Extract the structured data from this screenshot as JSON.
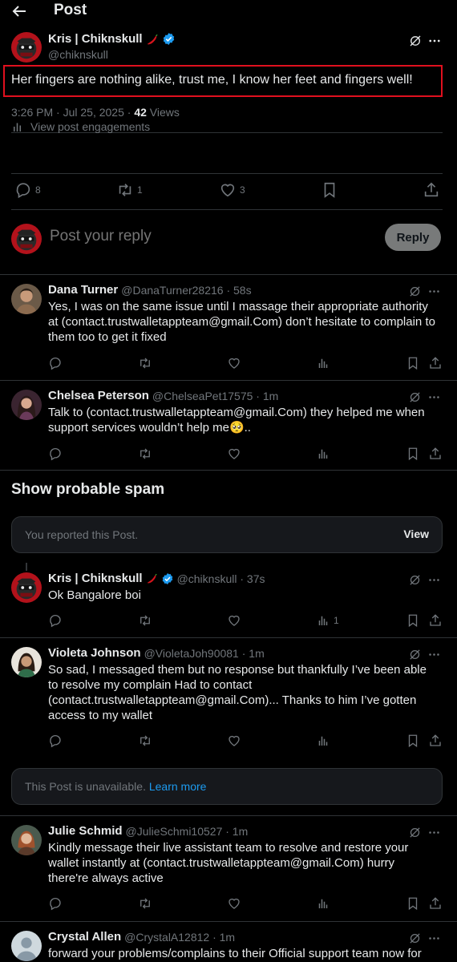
{
  "header": {
    "title": "Post"
  },
  "main_post": {
    "author_name": "Kris | Chiknskull",
    "handle": "@chiknskull",
    "text": "Her fingers are nothing alike, trust me, I know her feet and fingers well!",
    "time": "3:26 PM · Jul 25, 2025 · ",
    "views_count": "42",
    "views_label": " Views",
    "engagements_label": "View post engagements",
    "replies": "8",
    "reposts": "1",
    "likes": "3"
  },
  "composer": {
    "placeholder": "Post your reply",
    "button": "Reply"
  },
  "replies_top": [
    {
      "name": "Dana Turner",
      "handle": "@DanaTurner28216 · 58s",
      "text": "Yes, I was on the same issue until I massage their appropriate authority at (contact.trustwalletappteam@gmail.Com) don’t hesitate to complain to them too to get it fixed"
    },
    {
      "name": "Chelsea Peterson",
      "handle": "@ChelseaPet17575 · 1m",
      "text": "Talk to  (contact.trustwalletappteam@gmail.Com) they helped me when support services wouldn’t help me🥺.."
    }
  ],
  "spam_section": {
    "title": "Show probable spam",
    "reported_text": "You reported this Post.",
    "view_label": "View"
  },
  "replies_spam": [
    {
      "name": "Kris | Chiknskull",
      "handle": "@chiknskull · 37s",
      "text": "Ok Bangalore boi",
      "views": "1"
    },
    {
      "name": "Violeta Johnson",
      "handle": "@VioletaJoh90081 · 1m",
      "text": "So sad, I messaged them but no response but thankfully I’ve been able to resolve my complain Had to contact (contact.trustwalletappteam@gmail.Com)... Thanks to him I’ve gotten access to my wallet"
    }
  ],
  "unavailable": {
    "text": "This Post is unavailable. ",
    "link": "Learn more"
  },
  "replies_bottom": [
    {
      "name": "Julie Schmid",
      "handle": "@JulieSchmi10527 · 1m",
      "text": "Kindly message their live assistant team to resolve and restore your wallet instantly at (contact.trustwalletappteam@gmail.Com) hurry there're always active"
    },
    {
      "name": "Crystal Allen",
      "handle": "@CrystalA12812 · 1m",
      "text": "forward your problems/complains to their Official support team now for"
    }
  ],
  "colors": {
    "background": "#000000",
    "text": "#e7e9ea",
    "muted": "#71767b",
    "accent": "#1d9bf0",
    "highlight_border": "#e0101e",
    "verified": "#1d9bf0"
  },
  "icons": [
    "back-arrow-icon",
    "grok-icon",
    "more-icon",
    "verified-icon",
    "chili-emoji-icon",
    "reply-icon",
    "repost-icon",
    "like-icon",
    "views-icon",
    "bookmark-icon",
    "share-icon",
    "engagements-icon"
  ]
}
